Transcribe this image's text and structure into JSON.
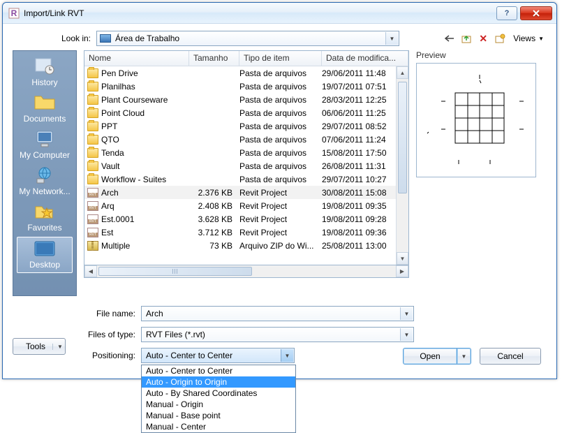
{
  "window": {
    "title": "Import/Link RVT"
  },
  "lookin": {
    "label": "Look in:",
    "value": "Área de Trabalho"
  },
  "toolbar": {
    "views": "Views"
  },
  "preview": {
    "label": "Preview"
  },
  "places": [
    {
      "key": "history",
      "label": "History"
    },
    {
      "key": "documents",
      "label": "Documents"
    },
    {
      "key": "mycomputer",
      "label": "My Computer"
    },
    {
      "key": "mynetwork",
      "label": "My Network..."
    },
    {
      "key": "favorites",
      "label": "Favorites"
    },
    {
      "key": "desktop",
      "label": "Desktop"
    }
  ],
  "columns": {
    "name": "Nome",
    "size": "Tamanho",
    "type": "Tipo de item",
    "date": "Data de modifica..."
  },
  "files": [
    {
      "icon": "folder",
      "name": "Pen Drive",
      "size": "",
      "type": "Pasta de arquivos",
      "date": "29/06/2011 11:48"
    },
    {
      "icon": "folder",
      "name": "Planilhas",
      "size": "",
      "type": "Pasta de arquivos",
      "date": "19/07/2011 07:51"
    },
    {
      "icon": "folder",
      "name": "Plant Courseware",
      "size": "",
      "type": "Pasta de arquivos",
      "date": "28/03/2011 12:25"
    },
    {
      "icon": "folder",
      "name": "Point Cloud",
      "size": "",
      "type": "Pasta de arquivos",
      "date": "06/06/2011 11:25"
    },
    {
      "icon": "folder",
      "name": "PPT",
      "size": "",
      "type": "Pasta de arquivos",
      "date": "29/07/2011 08:52"
    },
    {
      "icon": "folder",
      "name": "QTO",
      "size": "",
      "type": "Pasta de arquivos",
      "date": "07/06/2011 11:24"
    },
    {
      "icon": "folder",
      "name": "Tenda",
      "size": "",
      "type": "Pasta de arquivos",
      "date": "15/08/2011 17:50"
    },
    {
      "icon": "folder",
      "name": "Vault",
      "size": "",
      "type": "Pasta de arquivos",
      "date": "26/08/2011 11:31"
    },
    {
      "icon": "folder",
      "name": "Workflow - Suites",
      "size": "",
      "type": "Pasta de arquivos",
      "date": "29/07/2011 10:27"
    },
    {
      "icon": "rvt",
      "name": "Arch",
      "size": "2.376 KB",
      "type": "Revit Project",
      "date": "30/08/2011 15:08",
      "selected": true
    },
    {
      "icon": "rvt",
      "name": "Arq",
      "size": "2.408 KB",
      "type": "Revit Project",
      "date": "19/08/2011 09:35"
    },
    {
      "icon": "rvt",
      "name": "Est.0001",
      "size": "3.628 KB",
      "type": "Revit Project",
      "date": "19/08/2011 09:28"
    },
    {
      "icon": "rvt",
      "name": "Est",
      "size": "3.712 KB",
      "type": "Revit Project",
      "date": "19/08/2011 09:36"
    },
    {
      "icon": "zip",
      "name": "Multiple",
      "size": "73 KB",
      "type": "Arquivo ZIP do Wi...",
      "date": "25/08/2011 13:00"
    }
  ],
  "filename": {
    "label": "File name:",
    "value": "Arch"
  },
  "filetype": {
    "label": "Files of type:",
    "value": "RVT Files  (*.rvt)"
  },
  "positioning": {
    "label": "Positioning:",
    "value": "Auto - Center to Center",
    "options": [
      "Auto - Center to Center",
      "Auto - Origin to Origin",
      "Auto - By Shared Coordinates",
      "Manual - Origin",
      "Manual - Base point",
      "Manual - Center"
    ],
    "highlighted_index": 1
  },
  "buttons": {
    "tools": "Tools",
    "open": "Open",
    "cancel": "Cancel"
  }
}
